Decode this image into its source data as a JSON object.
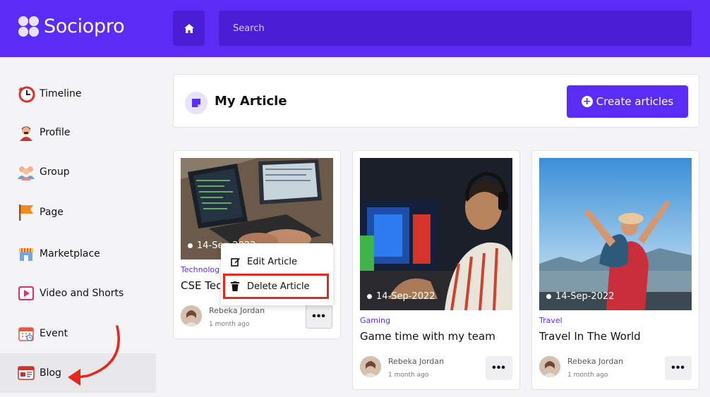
{
  "brand": {
    "name": "Sociopro"
  },
  "search": {
    "placeholder": "Search"
  },
  "sidebar": {
    "items": [
      {
        "label": "Timeline",
        "icon": "clock-icon"
      },
      {
        "label": "Profile",
        "icon": "person-icon"
      },
      {
        "label": "Group",
        "icon": "group-icon"
      },
      {
        "label": "Page",
        "icon": "flag-icon"
      },
      {
        "label": "Marketplace",
        "icon": "store-icon"
      },
      {
        "label": "Video and Shorts",
        "icon": "video-icon"
      },
      {
        "label": "Event",
        "icon": "calendar-icon"
      },
      {
        "label": "Blog",
        "icon": "blog-icon"
      }
    ],
    "active": "Blog"
  },
  "header": {
    "title": "My Article",
    "create_label": "Create articles"
  },
  "articles": [
    {
      "date": "14-Sep-2022",
      "category": "Technolog",
      "title": "CSE Tec",
      "author": "Rebeka Jordan",
      "time": "1 month ago"
    },
    {
      "date": "14-Sep-2022",
      "category": "Gaming",
      "title": "Game time with my team",
      "author": "Rebeka Jordan",
      "time": "1 month ago"
    },
    {
      "date": "14-Sep-2022",
      "category": "Travel",
      "title": "Travel In The World",
      "author": "Rebeka Jordan",
      "time": "1 month ago"
    }
  ],
  "context_menu": {
    "edit_label": "Edit Article",
    "delete_label": "Delete Article"
  },
  "colors": {
    "brand": "#5b2cf6",
    "brand_dark": "#4a1ed4",
    "highlight": "#e5271d"
  }
}
